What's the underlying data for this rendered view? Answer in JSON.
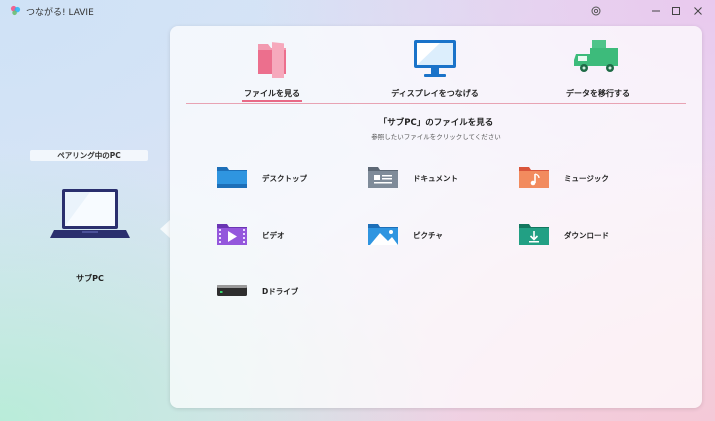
{
  "titlebar": {
    "title": "つながる! LAVIE",
    "icons": [
      "app-logo-icon",
      "help-icon",
      "minimize-icon",
      "maximize-icon",
      "close-icon"
    ]
  },
  "left": {
    "pairing_label": "ペアリング中のPC",
    "device_name": "サブPC",
    "device_icon": "laptop-icon"
  },
  "tabs": [
    {
      "label": "ファイルを見る",
      "icon": "folder-icon",
      "active": true
    },
    {
      "label": "ディスプレイをつなげる",
      "icon": "monitor-icon",
      "active": false
    },
    {
      "label": "データを移行する",
      "icon": "truck-icon",
      "active": false
    }
  ],
  "main": {
    "title": "「サブPC」のファイルを見る",
    "subtitle": "参照したいファイルをクリックしてください"
  },
  "folders": [
    {
      "label": "デスクトップ",
      "icon": "desktop-folder-icon",
      "color": "#2b8fd8"
    },
    {
      "label": "ドキュメント",
      "icon": "documents-folder-icon",
      "color": "#7a8796"
    },
    {
      "label": "ミュージック",
      "icon": "music-folder-icon",
      "color": "#ef7c52"
    },
    {
      "label": "ビデオ",
      "icon": "video-folder-icon",
      "color": "#8b4fd1"
    },
    {
      "label": "ピクチャ",
      "icon": "pictures-folder-icon",
      "color": "#2b8fd8"
    },
    {
      "label": "ダウンロード",
      "icon": "downloads-folder-icon",
      "color": "#1f9a80"
    },
    {
      "label": "Dドライブ",
      "icon": "drive-icon",
      "color": "#3a3a3a"
    }
  ],
  "colors": {
    "accent": "#e86a86",
    "panel": "#ffffff"
  }
}
